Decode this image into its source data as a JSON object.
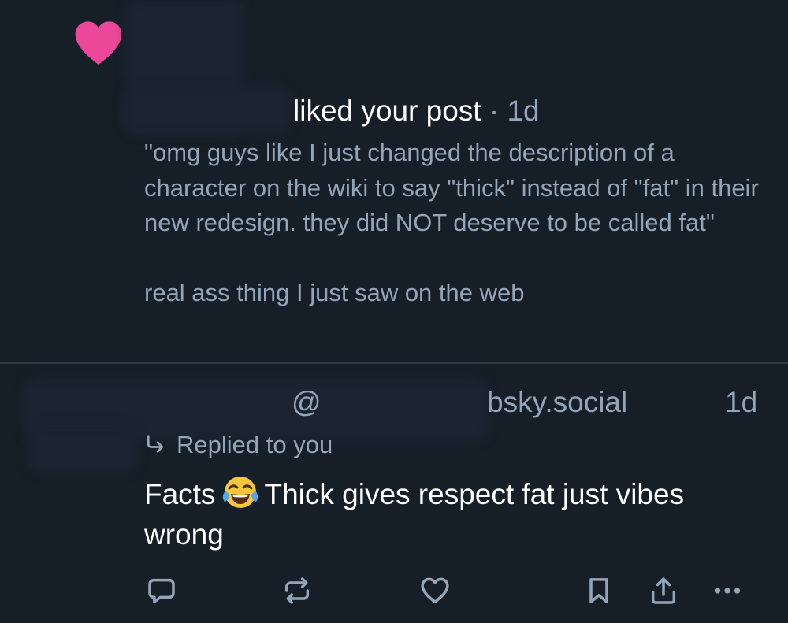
{
  "notification": {
    "action_text": "liked your post",
    "separator": "·",
    "time": "1d",
    "post_text": "\"omg guys like I just changed the description of a character on the wiki to say \"thick\" instead of \"fat\" in their new redesign. they did NOT deserve to be called fat\"\n\nreal ass thing I just saw on the web"
  },
  "reply": {
    "at_sign": "@",
    "handle_domain": "bsky.social",
    "time": "1d",
    "replied_label": "Replied to you",
    "text_before_emoji": "Facts",
    "emoji": "face-with-tears-of-joy",
    "text_after_emoji": "Thick gives respect fat just vibes wrong"
  },
  "icons": {
    "heart": "heart-icon",
    "reply": "comment-icon",
    "repost": "repost-icon",
    "like": "heart-outline-icon",
    "bookmark": "bookmark-icon",
    "share": "share-icon",
    "more": "more-icon"
  },
  "colors": {
    "background": "#161e27",
    "heart": "#ec4899",
    "muted_text": "#93a5b7",
    "icon": "#93a5b7"
  }
}
